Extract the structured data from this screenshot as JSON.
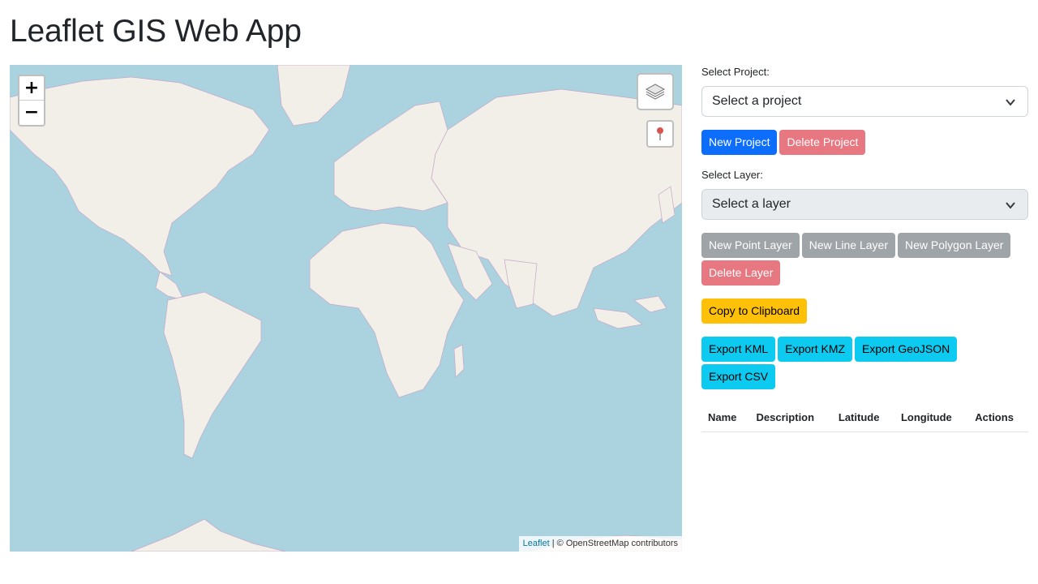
{
  "page": {
    "title": "Leaflet GIS Web App"
  },
  "map": {
    "zoom_in_label": "+",
    "zoom_out_label": "−",
    "layers_icon": "layers-icon",
    "marker_icon": "map-pin-icon",
    "attribution": {
      "link": "Leaflet",
      "separator": " | ",
      "text": "© OpenStreetMap contributors"
    },
    "colors": {
      "water": "#aad3df",
      "land": "#f2efe9",
      "border": "#c5a6c9"
    }
  },
  "project": {
    "label": "Select Project:",
    "selected": "Select a project",
    "new_button": "New Project",
    "delete_button": "Delete Project"
  },
  "layer": {
    "label": "Select Layer:",
    "selected": "Select a layer",
    "new_point_button": "New Point Layer",
    "new_line_button": "New Line Layer",
    "new_polygon_button": "New Polygon Layer",
    "delete_button": "Delete Layer"
  },
  "actions": {
    "copy_button": "Copy to Clipboard",
    "export_kml": "Export KML",
    "export_kmz": "Export KMZ",
    "export_geojson": "Export GeoJSON",
    "export_csv": "Export CSV"
  },
  "table": {
    "columns": [
      "Name",
      "Description",
      "Latitude",
      "Longitude",
      "Actions"
    ],
    "rows": []
  },
  "colors": {
    "primary": "#0d6efd",
    "danger_disabled": "#e77780",
    "secondary_disabled": "#9fa4a9",
    "warning": "#ffc107",
    "info": "#0dcaf0"
  }
}
